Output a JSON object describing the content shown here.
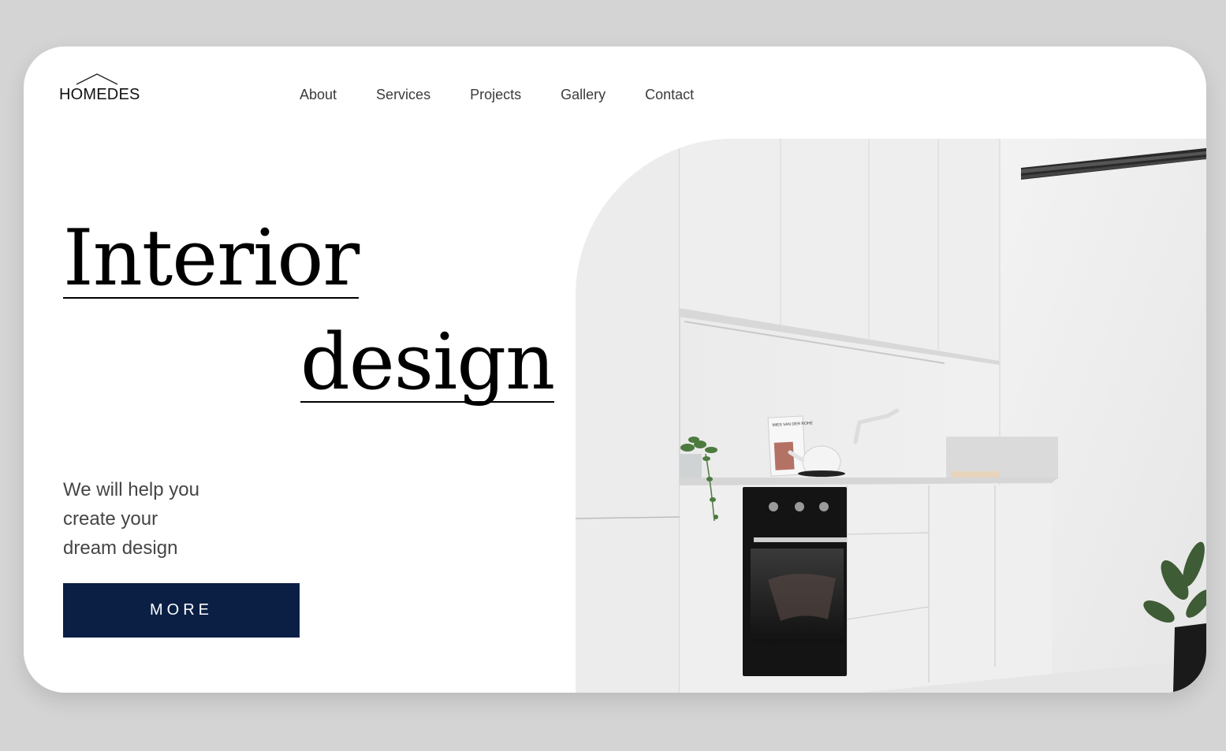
{
  "header": {
    "logo_text": "HOMEDES",
    "nav": [
      "About",
      "Services",
      "Projects",
      "Gallery",
      "Contact"
    ]
  },
  "hero": {
    "title_line1": "Interior",
    "title_line2": "design",
    "tagline": [
      "We will help you",
      "create your",
      "dream design"
    ],
    "button_label": "MORE",
    "book_title": "MIES VAN DER ROHE"
  },
  "colors": {
    "page_bg": "#d4d4d4",
    "card_bg": "#ffffff",
    "button_bg": "#0b1f45",
    "button_text": "#ffffff",
    "nav_text": "#3b3b3b"
  }
}
